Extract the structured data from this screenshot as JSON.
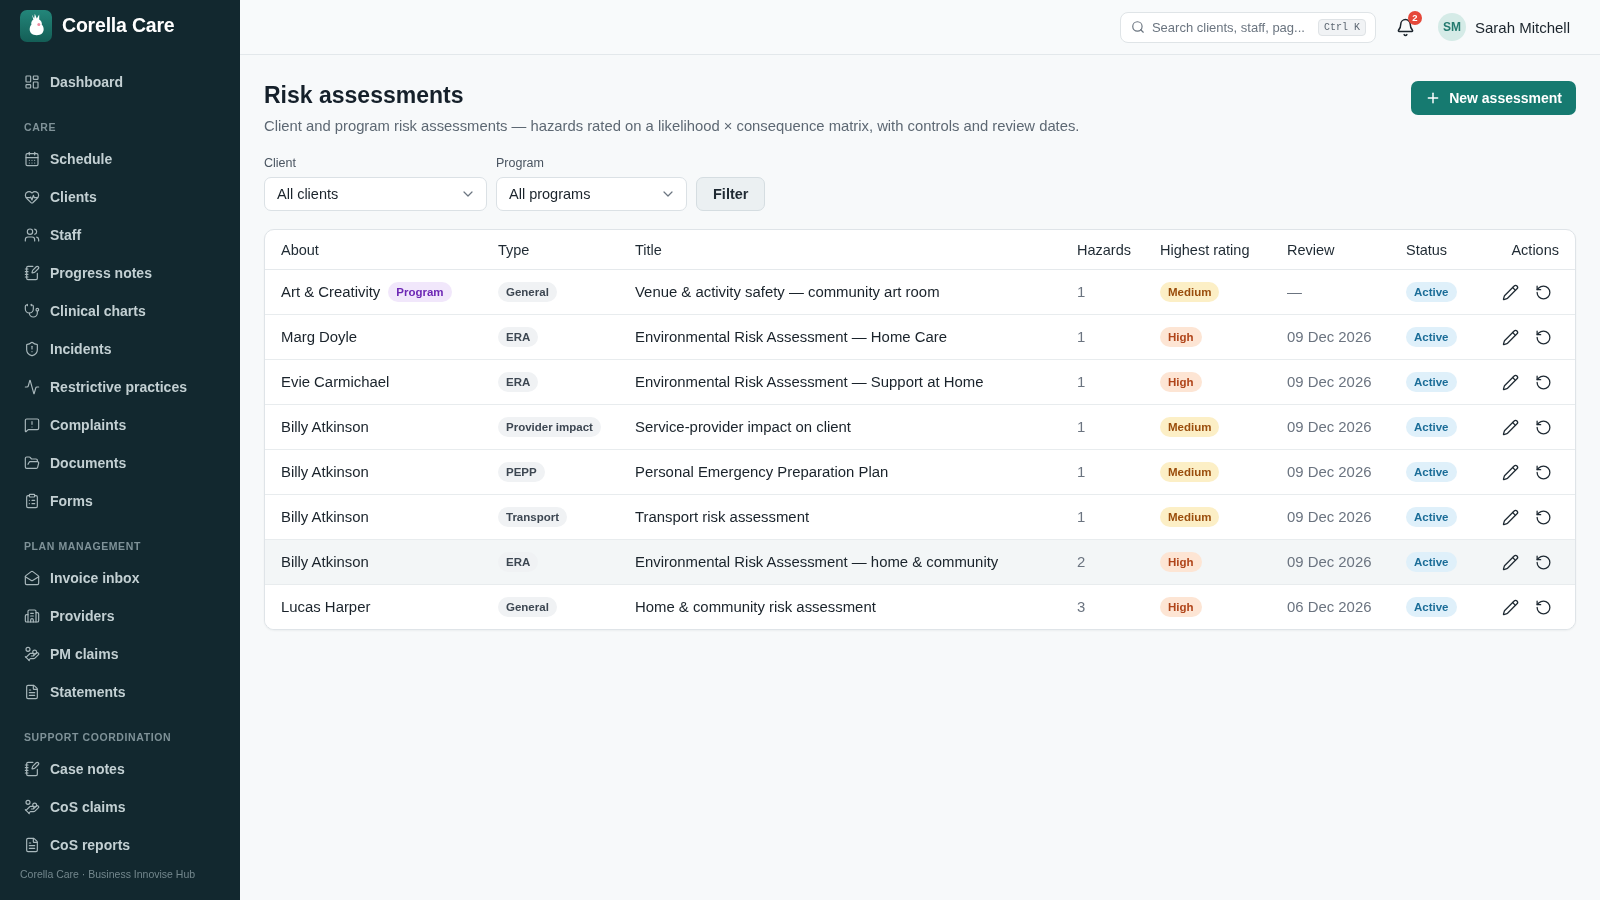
{
  "sidebar": {
    "brand": "Corella Care",
    "sections": [
      {
        "items": [
          {
            "label": "Dashboard",
            "selected": false
          }
        ]
      },
      {
        "heading": "CARE",
        "items": [
          {
            "label": "Schedule",
            "selected": false
          },
          {
            "label": "Clients",
            "selected": false
          },
          {
            "label": "Staff",
            "selected": false
          },
          {
            "label": "Progress notes",
            "selected": false
          },
          {
            "label": "Clinical charts",
            "selected": false
          },
          {
            "label": "Incidents",
            "selected": false
          },
          {
            "label": "Restrictive practices",
            "selected": false
          },
          {
            "label": "Complaints",
            "selected": false
          },
          {
            "label": "Documents",
            "selected": false
          },
          {
            "label": "Forms",
            "selected": false
          }
        ]
      },
      {
        "heading": "PLAN MANAGEMENT",
        "items": [
          {
            "label": "Invoice inbox",
            "selected": false
          },
          {
            "label": "Providers",
            "selected": false
          },
          {
            "label": "PM claims",
            "selected": false
          },
          {
            "label": "Statements",
            "selected": false
          }
        ]
      },
      {
        "heading": "SUPPORT COORDINATION",
        "items": [
          {
            "label": "Case notes",
            "selected": false
          },
          {
            "label": "CoS claims",
            "selected": false
          },
          {
            "label": "CoS reports",
            "selected": false
          }
        ]
      }
    ],
    "footer": "Corella Care · Business Innovise Hub"
  },
  "topbar": {
    "search": {
      "placeholder": "Search clients, staff, pag...",
      "shortcut": "Ctrl K"
    },
    "notifications": {
      "count": "2"
    },
    "user": {
      "initials": "SM",
      "name": "Sarah Mitchell"
    }
  },
  "page": {
    "title": "Risk assessments",
    "subtitle": "Client and program risk assessments — hazards rated on a likelihood × consequence matrix, with controls and review dates.",
    "primary_action": "New assessment"
  },
  "filters": [
    {
      "label": "Client",
      "value": "All clients"
    },
    {
      "label": "Program",
      "value": "All programs"
    }
  ],
  "filter_button": "Filter",
  "table": {
    "columns": [
      "About",
      "Type",
      "Title",
      "Hazards",
      "Highest rating",
      "Review",
      "Status",
      "Actions"
    ],
    "rows": [
      {
        "about": "Art & Creativity",
        "tag": "Program",
        "type": "General",
        "title": "Venue & activity safety — community art room",
        "hazards": "1",
        "rating": {
          "text": "Medium",
          "kind": "medium"
        },
        "review": "—",
        "status": {
          "text": "Active",
          "kind": "active"
        },
        "highlighted": false
      },
      {
        "about": "Marg Doyle",
        "type": "ERA",
        "title": "Environmental Risk Assessment — Home Care",
        "hazards": "1",
        "rating": {
          "text": "High",
          "kind": "high"
        },
        "review": "09 Dec 2026",
        "status": {
          "text": "Active",
          "kind": "active"
        },
        "highlighted": false
      },
      {
        "about": "Evie Carmichael",
        "type": "ERA",
        "title": "Environmental Risk Assessment — Support at Home",
        "hazards": "1",
        "rating": {
          "text": "High",
          "kind": "high"
        },
        "review": "09 Dec 2026",
        "status": {
          "text": "Active",
          "kind": "active"
        },
        "highlighted": false
      },
      {
        "about": "Billy Atkinson",
        "type": "Provider impact",
        "title": "Service-provider impact on client",
        "hazards": "1",
        "rating": {
          "text": "Medium",
          "kind": "medium"
        },
        "review": "09 Dec 2026",
        "status": {
          "text": "Active",
          "kind": "active"
        },
        "highlighted": false
      },
      {
        "about": "Billy Atkinson",
        "type": "PEPP",
        "title": "Personal Emergency Preparation Plan",
        "hazards": "1",
        "rating": {
          "text": "Medium",
          "kind": "medium"
        },
        "review": "09 Dec 2026",
        "status": {
          "text": "Active",
          "kind": "active"
        },
        "highlighted": false
      },
      {
        "about": "Billy Atkinson",
        "type": "Transport",
        "title": "Transport risk assessment",
        "hazards": "1",
        "rating": {
          "text": "Medium",
          "kind": "medium"
        },
        "review": "09 Dec 2026",
        "status": {
          "text": "Active",
          "kind": "active"
        },
        "highlighted": false
      },
      {
        "about": "Billy Atkinson",
        "type": "ERA",
        "title": "Environmental Risk Assessment — home & community",
        "hazards": "2",
        "rating": {
          "text": "High",
          "kind": "high"
        },
        "review": "09 Dec 2026",
        "status": {
          "text": "Active",
          "kind": "active"
        },
        "highlighted": true
      },
      {
        "about": "Lucas Harper",
        "type": "General",
        "title": "Home & community risk assessment",
        "hazards": "3",
        "rating": {
          "text": "High",
          "kind": "high"
        },
        "review": "06 Dec 2026",
        "status": {
          "text": "Active",
          "kind": "active"
        },
        "highlighted": false
      }
    ]
  }
}
